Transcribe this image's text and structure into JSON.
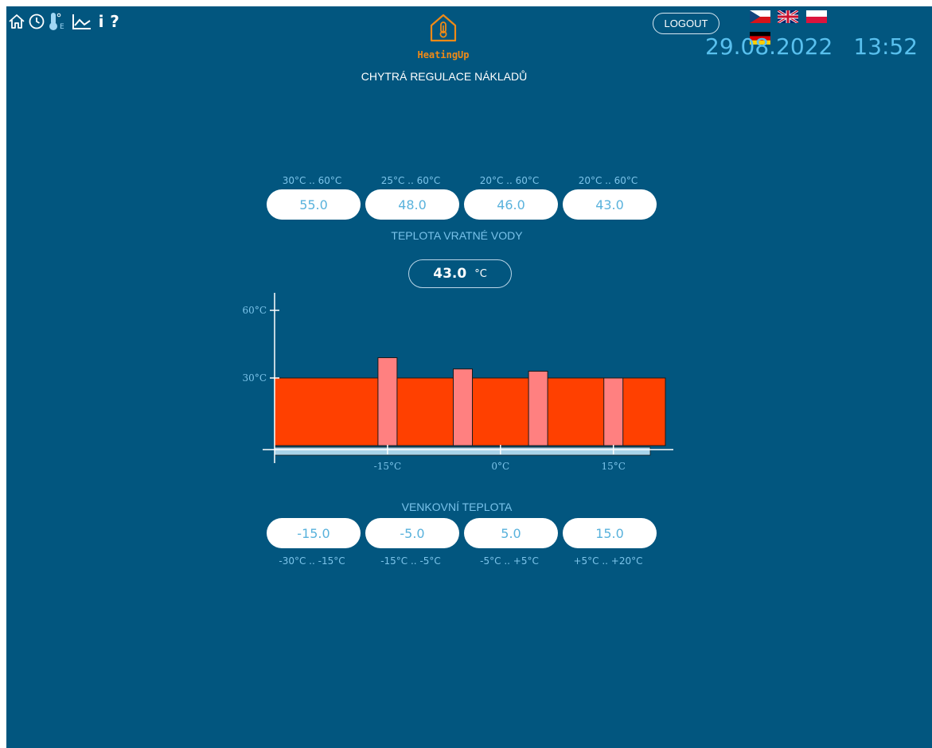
{
  "nav": {
    "icons": [
      "home-icon",
      "clock-icon",
      "thermometer-e-icon",
      "chart-icon",
      "info-icon",
      "help-icon"
    ],
    "info_label": "i",
    "help_label": "?"
  },
  "header": {
    "brand": "HeatingUp",
    "subtitle": "CHYTRÁ REGULACE NÁKLADŮ",
    "logout_label": "LOGOUT",
    "date": "29.08.2022",
    "time": "13:52",
    "languages": [
      "cz",
      "en",
      "pl",
      "de"
    ]
  },
  "return_water": {
    "label": "TEPLOTA VRATNÉ VODY",
    "ranges": [
      "30°C .. 60°C",
      "25°C .. 60°C",
      "20°C .. 60°C",
      "20°C .. 60°C"
    ],
    "values": [
      "55.0",
      "48.0",
      "46.0",
      "43.0"
    ]
  },
  "current": {
    "value": "43.0",
    "unit": "°C"
  },
  "outdoor": {
    "label": "VENKOVNÍ TEPLOTA",
    "values": [
      "-15.0",
      "-5.0",
      "5.0",
      "15.0"
    ],
    "ranges": [
      "-30°C .. -15°C",
      "-15°C .. -5°C",
      "-5°C .. +5°C",
      "+5°C .. +20°C"
    ]
  },
  "colors": {
    "background": "#02567f",
    "accent": "#59c0ee",
    "brand": "#f08a16",
    "bar_main": "#ff4000",
    "bar_marker": "#ff8080",
    "x_band": "#a9d4ea"
  },
  "chart_data": {
    "type": "bar",
    "ylim": [
      0,
      60
    ],
    "yticks": [
      "60°C",
      "30°C"
    ],
    "xticks": [
      "-15°C",
      "0°C",
      "15°C"
    ],
    "xlim": [
      -30,
      20
    ],
    "series": [
      {
        "values": [
          30,
          30,
          30,
          30
        ]
      },
      {
        "values": [
          39,
          34,
          33,
          30
        ]
      }
    ],
    "categories": [
      -15,
      -5,
      5,
      15
    ]
  }
}
